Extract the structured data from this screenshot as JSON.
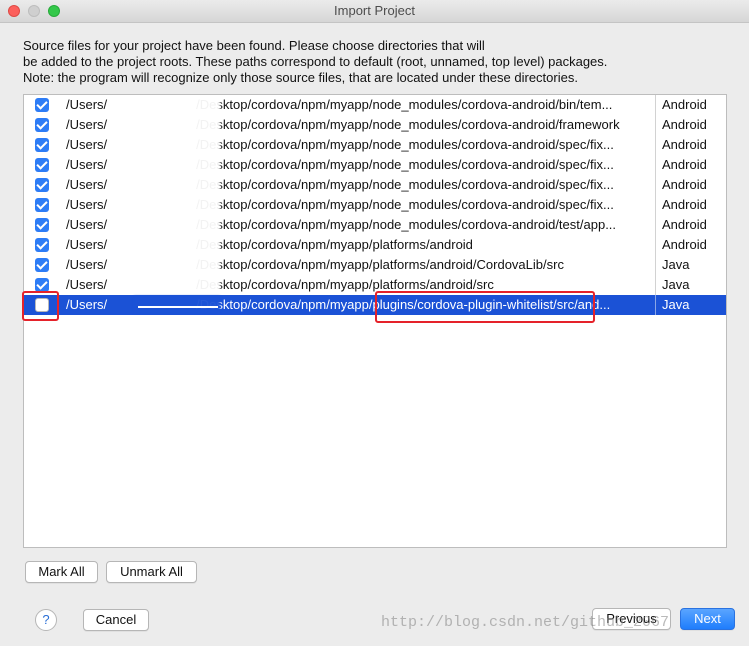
{
  "window": {
    "title": "Import Project"
  },
  "description": {
    "lines": [
      "Source files for your project have been found. Please choose directories that will",
      "be added to the project roots. These paths correspond to default (root, unnamed, top level) packages.",
      "Note: the program will recognize only those source files, that are located under these directories."
    ]
  },
  "rows": [
    {
      "checked": true,
      "path_prefix": "/Users/",
      "path_suffix": "/Desktop/cordova/npm/myapp/node_modules/cordova-android/bin/tem...",
      "type": "Android"
    },
    {
      "checked": true,
      "path_prefix": "/Users/",
      "path_suffix": "/Desktop/cordova/npm/myapp/node_modules/cordova-android/framework",
      "type": "Android"
    },
    {
      "checked": true,
      "path_prefix": "/Users/",
      "path_suffix": "/Desktop/cordova/npm/myapp/node_modules/cordova-android/spec/fix...",
      "type": "Android"
    },
    {
      "checked": true,
      "path_prefix": "/Users/",
      "path_suffix": "/Desktop/cordova/npm/myapp/node_modules/cordova-android/spec/fix...",
      "type": "Android"
    },
    {
      "checked": true,
      "path_prefix": "/Users/",
      "path_suffix": "/Desktop/cordova/npm/myapp/node_modules/cordova-android/spec/fix...",
      "type": "Android"
    },
    {
      "checked": true,
      "path_prefix": "/Users/",
      "path_suffix": "/Desktop/cordova/npm/myapp/node_modules/cordova-android/spec/fix...",
      "type": "Android"
    },
    {
      "checked": true,
      "path_prefix": "/Users/",
      "path_suffix": "/Desktop/cordova/npm/myapp/node_modules/cordova-android/test/app...",
      "type": "Android"
    },
    {
      "checked": true,
      "path_prefix": "/Users/",
      "path_suffix": "/Desktop/cordova/npm/myapp/platforms/android",
      "type": "Android"
    },
    {
      "checked": true,
      "path_prefix": "/Users/",
      "path_suffix": "/Desktop/cordova/npm/myapp/platforms/android/CordovaLib/src",
      "type": "Java"
    },
    {
      "checked": true,
      "path_prefix": "/Users/",
      "path_suffix": "/Desktop/cordova/npm/myapp/platforms/android/src",
      "type": "Java"
    },
    {
      "checked": false,
      "path_prefix": "/Users/",
      "path_suffix": "/Desktop/cordova/npm/myapp/plugins/cordova-plugin-whitelist/src/and...",
      "type": "Java",
      "selected": true
    }
  ],
  "buttons": {
    "mark_all": "Mark All",
    "unmark_all": "Unmark All",
    "help": "?",
    "cancel": "Cancel",
    "previous": "Previous",
    "next": "Next"
  },
  "watermark": "http://blog.csdn.net/github_2067"
}
